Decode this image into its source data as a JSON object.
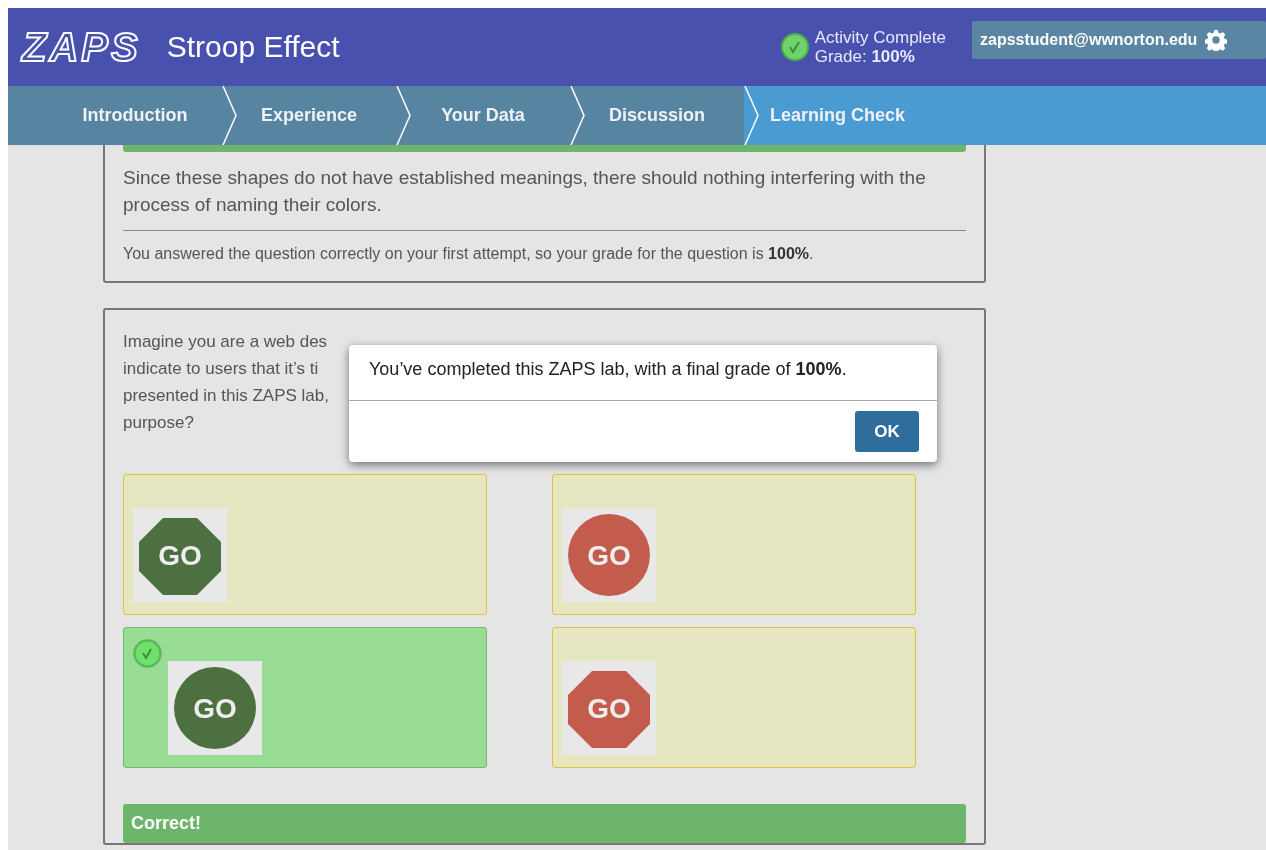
{
  "header": {
    "logo": "ZAPS",
    "title": "Stroop Effect",
    "status": {
      "complete": true,
      "label": "Activity Complete",
      "grade": "Grade: **100%**"
    },
    "user": "zapsstudent@wwnorton.edu"
  },
  "nav": [
    {
      "label": "Introduction",
      "selected": false
    },
    {
      "label": "Experience",
      "selected": false
    },
    {
      "label": "Your Data",
      "selected": false
    },
    {
      "label": "Discussion",
      "selected": false
    },
    {
      "label": "Learning Check",
      "selected": true
    }
  ],
  "feedback": {
    "explanation": "Since these shapes do not have established meanings, there should nothing interfering with the process of naming their colors.",
    "grade_note": "You answered the question correctly on your first attempt, so your grade for the question is **100%**."
  },
  "question": {
    "text_lines": [
      "Imagine you are a web des",
      "indicate to users that it’s ti",
      "presented in this ZAPS lab,",
      "purpose?"
    ],
    "options": [
      {
        "kind": "octagon",
        "color": "#4d7040",
        "label": "GO",
        "selected": false
      },
      {
        "kind": "circle",
        "color": "#c45c4e",
        "label": "GO",
        "selected": false
      },
      {
        "kind": "circle",
        "color": "#4d7040",
        "label": "GO",
        "selected": true
      },
      {
        "kind": "octagon",
        "color": "#c45c4e",
        "label": "GO",
        "selected": false
      }
    ],
    "result": "Correct!"
  },
  "dialog": {
    "message": "You’ve completed this ZAPS lab, with a final grade of **100%**.",
    "button": "OK"
  }
}
